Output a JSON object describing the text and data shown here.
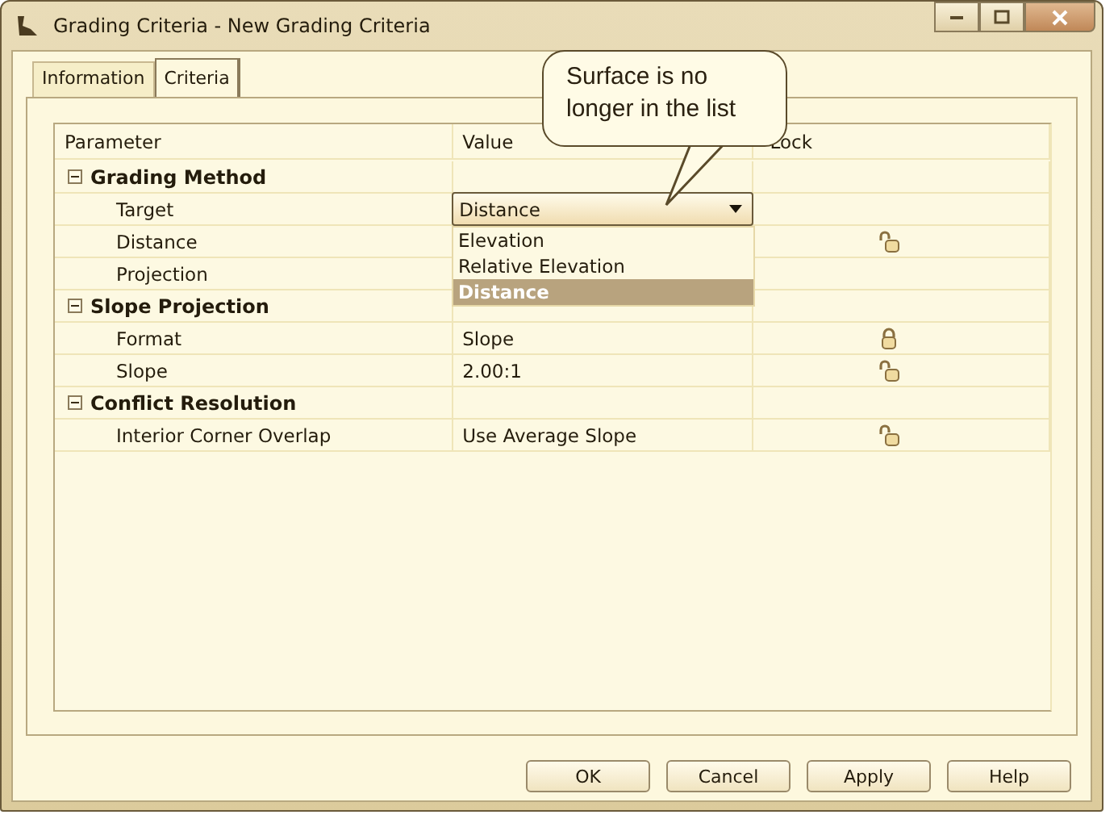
{
  "window": {
    "title": "Grading Criteria - New Grading Criteria"
  },
  "tabs": [
    {
      "label": "Information",
      "selected": false
    },
    {
      "label": "Criteria",
      "selected": true
    }
  ],
  "callout": {
    "text": "Surface is no longer in the list"
  },
  "grid": {
    "columns": [
      "Parameter",
      "Value",
      "Lock"
    ],
    "rows": [
      {
        "kind": "group",
        "label": "Grading Method",
        "expanded": true
      },
      {
        "kind": "dropdown",
        "label": "Target",
        "value": "Distance"
      },
      {
        "kind": "item",
        "label": "Distance",
        "locked": false
      },
      {
        "kind": "item",
        "label": "Projection"
      },
      {
        "kind": "group",
        "label": "Slope Projection",
        "expanded": true
      },
      {
        "kind": "item",
        "label": "Format",
        "value": "Slope",
        "locked": true
      },
      {
        "kind": "item",
        "label": "Slope",
        "value": "2.00:1",
        "locked": false
      },
      {
        "kind": "group",
        "label": "Conflict Resolution",
        "expanded": true
      },
      {
        "kind": "item",
        "label": "Interior Corner Overlap",
        "value": "Use Average Slope",
        "locked": false
      }
    ]
  },
  "dropdown_options": [
    {
      "label": "Elevation",
      "selected": false
    },
    {
      "label": "Relative Elevation",
      "selected": false
    },
    {
      "label": "Distance",
      "selected": true
    }
  ],
  "buttons": [
    "OK",
    "Cancel",
    "Apply",
    "Help"
  ]
}
